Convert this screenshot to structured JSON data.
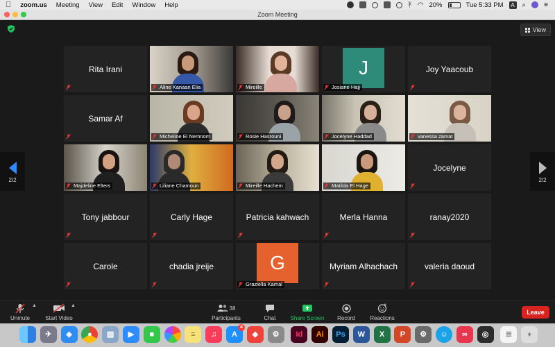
{
  "menubar": {
    "app": "zoom.us",
    "items": [
      "Meeting",
      "View",
      "Edit",
      "Window",
      "Help"
    ],
    "battery": "20%",
    "clock": "Tue 5:33 PM",
    "input_source": "A"
  },
  "window": {
    "title": "Zoom Meeting"
  },
  "view_button": {
    "label": "View"
  },
  "pagination": {
    "prev": "2/2",
    "next": "2/2"
  },
  "tiles": [
    {
      "name": "Rita Irani",
      "mode": "name"
    },
    {
      "name": "Aline Kanaan Elia",
      "mode": "video"
    },
    {
      "name": "Mireille",
      "mode": "video"
    },
    {
      "name": "Josiane Hajj",
      "mode": "avatar",
      "initial": "J",
      "color": "#2e8b7a"
    },
    {
      "name": "Joy Yaacoub",
      "mode": "name"
    },
    {
      "name": "Samar Af",
      "mode": "name"
    },
    {
      "name": "Micheline El Nemnom",
      "mode": "video"
    },
    {
      "name": "Rosie Hasrouni",
      "mode": "video"
    },
    {
      "name": "Jocelyne Haddad",
      "mode": "video"
    },
    {
      "name": "vanessa zamat",
      "mode": "video"
    },
    {
      "name": "Majdeline Elters",
      "mode": "video"
    },
    {
      "name": "Liliane Chamoun",
      "mode": "video"
    },
    {
      "name": "Mireille Hachem",
      "mode": "video"
    },
    {
      "name": "Matilda El Hage",
      "mode": "video"
    },
    {
      "name": "Jocelyne",
      "mode": "name"
    },
    {
      "name": "Tony jabbour",
      "mode": "name"
    },
    {
      "name": "Carly Hage",
      "mode": "name"
    },
    {
      "name": "Patricia kahwach",
      "mode": "name"
    },
    {
      "name": "Merla Hanna",
      "mode": "name"
    },
    {
      "name": "ranay2020",
      "mode": "name"
    },
    {
      "name": "Carole",
      "mode": "name"
    },
    {
      "name": "chadia jreije",
      "mode": "name"
    },
    {
      "name": "Graziella Kamal",
      "mode": "avatar",
      "initial": "G",
      "color": "#e5622f"
    },
    {
      "name": "Myriam Alhachach",
      "mode": "name"
    },
    {
      "name": "valeria daoud",
      "mode": "name"
    }
  ],
  "toolbar": {
    "unmute": "Unmute",
    "start_video": "Start Video",
    "participants": "Participants",
    "participants_count": "38",
    "chat": "Chat",
    "share_screen": "Share Screen",
    "record": "Record",
    "reactions": "Reactions",
    "leave": "Leave"
  },
  "dock": {
    "apps": [
      "finder-icon",
      "launchpad-icon",
      "safari-icon",
      "chrome-icon",
      "preview-icon",
      "zoom-icon",
      "facetime-icon",
      "photos-icon",
      "notes-icon",
      "music-icon",
      "app-store-icon",
      "anydesk-icon",
      "system-preferences-icon",
      "indesign-icon",
      "illustrator-icon",
      "photoshop-icon",
      "word-icon",
      "excel-icon",
      "powerpoint-icon",
      "automator-icon",
      "accessibility-icon",
      "creative-cloud-icon",
      "vpn-icon",
      "text-document-icon",
      "trash-icon"
    ],
    "labels": {
      "indesign": "Id",
      "illustrator": "Ai",
      "photoshop": "Ps",
      "word": "W",
      "excel": "X",
      "powerpoint": "P"
    },
    "app_store_badge": "4"
  }
}
